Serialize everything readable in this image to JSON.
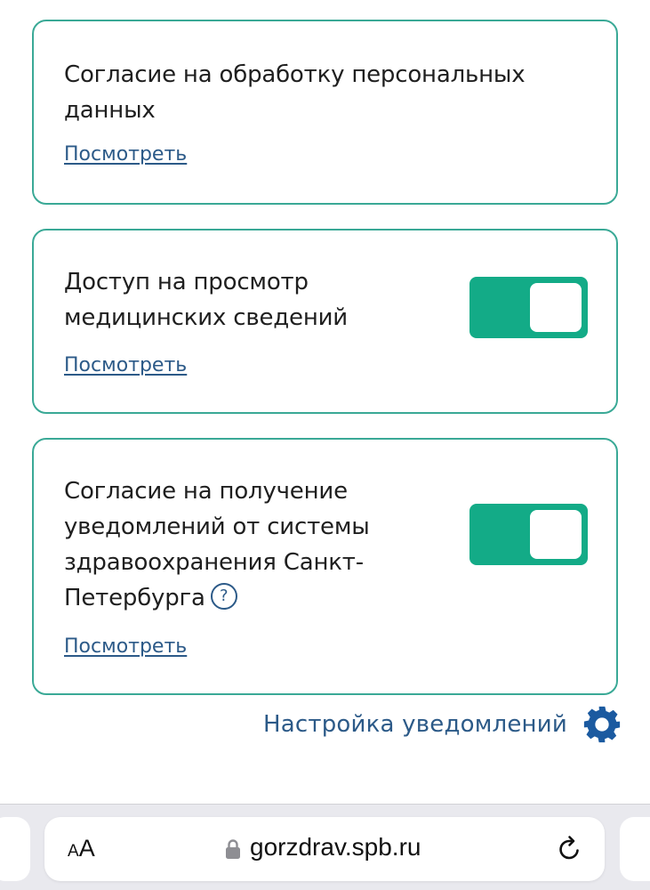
{
  "cards": [
    {
      "title": "Согласие на обработку персональных данных",
      "link": "Посмотреть"
    },
    {
      "title": "Доступ на просмотр медицинских сведений",
      "link": "Посмотреть",
      "toggle_on": true
    },
    {
      "title": "Согласие на получение уведомлений от системы здравоохранения Санкт-Петербурга",
      "help_icon": "?",
      "link": "Посмотреть",
      "toggle_on": true
    }
  ],
  "notification_settings": {
    "label": "Настройка уведомлений",
    "icon": "gear-icon"
  },
  "browser": {
    "text_size_small": "A",
    "text_size_big": "A",
    "url": "gorzdrav.spb.ru",
    "lock_icon": "lock-icon",
    "reload_icon": "reload-icon"
  },
  "colors": {
    "card_border": "#3aa996",
    "toggle_on": "#13ab87",
    "link": "#2c5a88",
    "text": "#1f1f1f"
  }
}
